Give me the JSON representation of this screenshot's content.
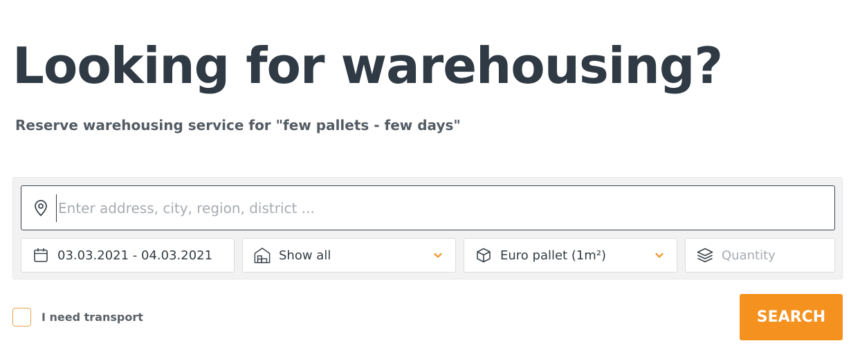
{
  "hero": {
    "title": "Looking for warehousing?",
    "subtitle": "Reserve warehousing service for \"few pallets - few days\""
  },
  "search": {
    "address_placeholder": "Enter address, city, region, district ...",
    "date_range": "03.03.2021 - 04.03.2021",
    "warehouse_type": "Show all",
    "pallet_type": "Euro pallet (1m²)",
    "quantity_placeholder": "Quantity",
    "transport_label": "I need transport",
    "search_label": "SEARCH"
  },
  "icons": {
    "address": "map-pin-icon",
    "date": "calendar-icon",
    "warehouse": "warehouse-icon",
    "pallet": "box-icon",
    "quantity": "layers-icon",
    "dropdown": "chevron-down-icon"
  },
  "colors": {
    "accent": "#f5911e",
    "heading": "#2f3a44",
    "panel_bg": "#f2f2f2",
    "checkbox_border": "#e8a34a"
  }
}
